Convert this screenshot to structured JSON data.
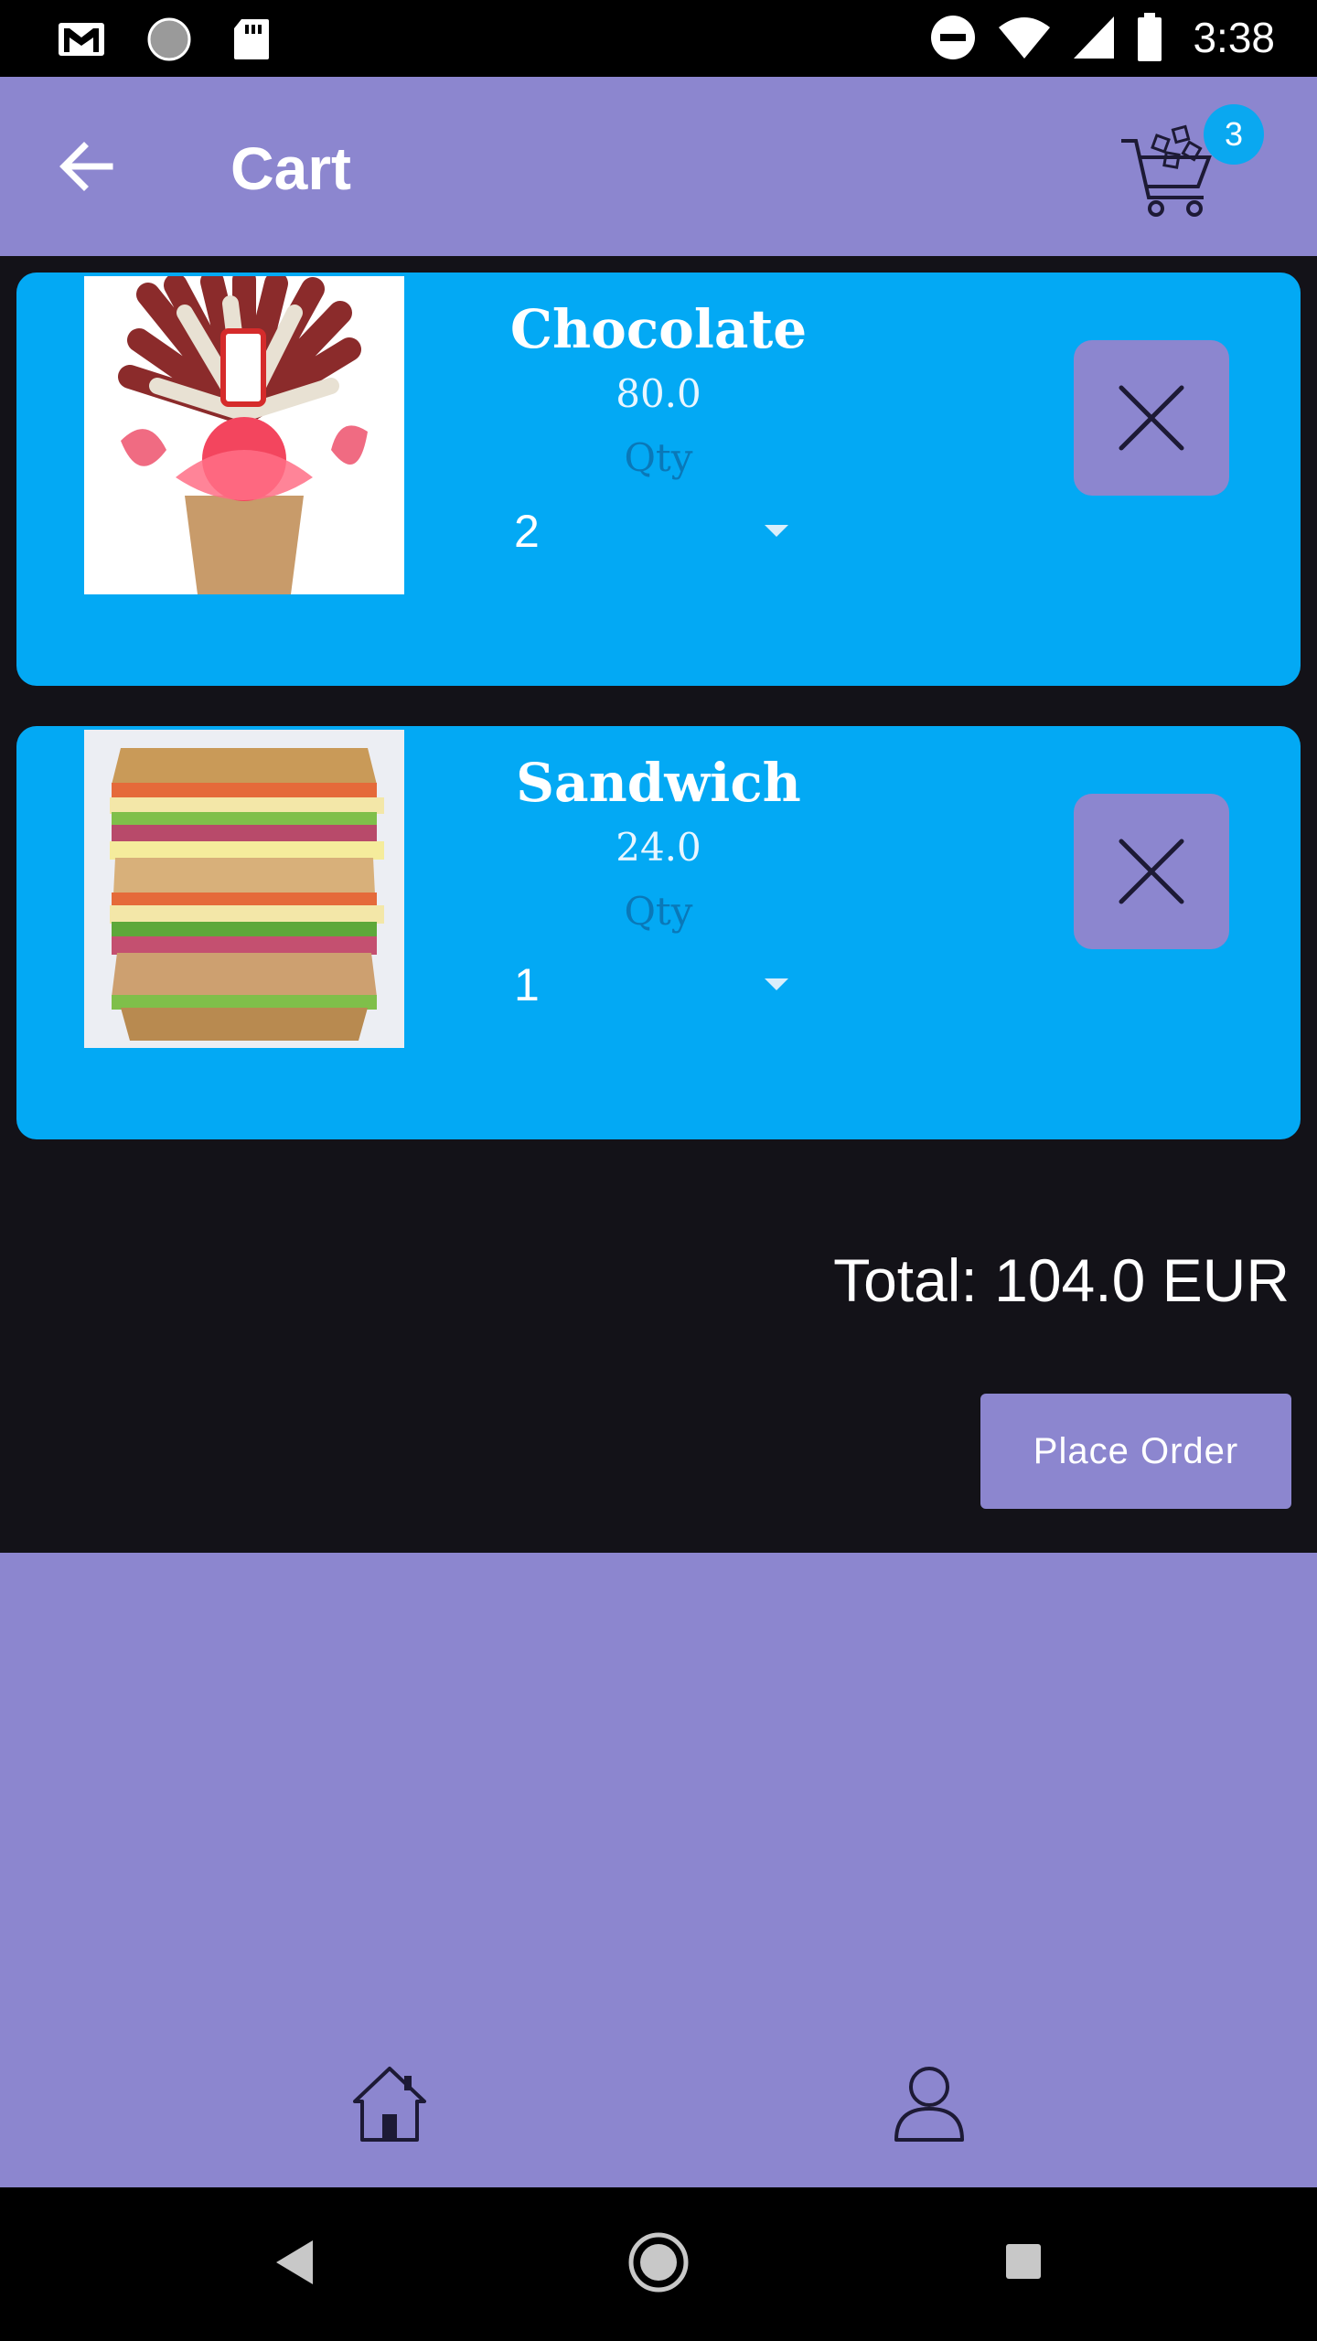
{
  "status_bar": {
    "time": "3:38",
    "icons": [
      "gmail-icon",
      "circle-icon",
      "sd-card-icon",
      "do-not-disturb-icon",
      "wifi-icon",
      "signal-icon",
      "battery-icon"
    ]
  },
  "app_bar": {
    "title": "Cart",
    "back_icon": "arrow-left-icon",
    "cart_icon": "shopping-cart-icon",
    "cart_badge_count": "3",
    "badge_color": "#0aa8f0",
    "background_color": "#8c86cf"
  },
  "cart_items": [
    {
      "name": "Chocolate",
      "price": "80.0",
      "qty_label": "Qty",
      "qty_value": "2",
      "image": "chocolate-bouquet-image",
      "remove_icon": "close-icon"
    },
    {
      "name": "Sandwich",
      "price": "24.0",
      "qty_label": "Qty",
      "qty_value": "1",
      "image": "sandwich-image",
      "remove_icon": "close-icon"
    }
  ],
  "summary": {
    "total_text": "Total: 104.0 EUR",
    "place_order_label": "Place Order"
  },
  "bottom_nav": {
    "items": [
      "home-icon",
      "profile-icon"
    ]
  },
  "system_nav": {
    "items": [
      "back-triangle-icon",
      "home-circle-icon",
      "recents-square-icon"
    ]
  },
  "colors": {
    "card": "#03a9f4",
    "accent": "#8c86cf",
    "background": "#131218"
  }
}
